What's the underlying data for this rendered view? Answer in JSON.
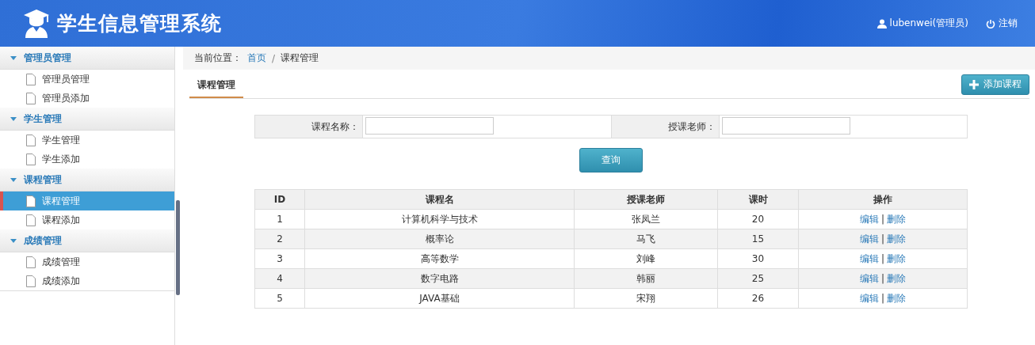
{
  "header": {
    "title": "学生信息管理系统",
    "user": "lubenwei(管理员)",
    "logout": "注销"
  },
  "sidebar": {
    "groups": [
      {
        "label": "管理员管理",
        "expanded": true,
        "items": [
          {
            "label": "管理员管理",
            "selected": false
          },
          {
            "label": "管理员添加",
            "selected": false
          }
        ]
      },
      {
        "label": "学生管理",
        "expanded": true,
        "items": [
          {
            "label": "学生管理",
            "selected": false
          },
          {
            "label": "学生添加",
            "selected": false
          }
        ]
      },
      {
        "label": "课程管理",
        "expanded": true,
        "items": [
          {
            "label": "课程管理",
            "selected": true
          },
          {
            "label": "课程添加",
            "selected": false
          }
        ]
      },
      {
        "label": "成绩管理",
        "expanded": true,
        "items": [
          {
            "label": "成绩管理",
            "selected": false
          },
          {
            "label": "成绩添加",
            "selected": false
          }
        ]
      }
    ]
  },
  "breadcrumb": {
    "label": "当前位置：",
    "links": [
      "首页"
    ],
    "separator": "/",
    "current": "课程管理"
  },
  "tabs": [
    {
      "label": "课程管理",
      "selected": true
    }
  ],
  "add_button": {
    "label": "添加课程"
  },
  "search": {
    "fields": [
      {
        "label": "课程名称："
      },
      {
        "label": "授课老师："
      }
    ],
    "button": "查询"
  },
  "table": {
    "columns": [
      "ID",
      "课程名",
      "授课老师",
      "课时",
      "操作"
    ],
    "rows": [
      {
        "cells": [
          "1",
          "计算机科学与技术",
          "张凤兰",
          "20"
        ],
        "actions": [
          {
            "kind": "link",
            "text": "编辑"
          },
          {
            "kind": "separator",
            "text": "|"
          },
          {
            "kind": "link",
            "text": "删除"
          }
        ]
      },
      {
        "cells": [
          "2",
          "概率论",
          "马飞",
          "15"
        ],
        "actions": [
          {
            "kind": "link",
            "text": "编辑"
          },
          {
            "kind": "separator",
            "text": "|"
          },
          {
            "kind": "link",
            "text": "删除"
          }
        ]
      },
      {
        "cells": [
          "3",
          "高等数学",
          "刘峰",
          "30"
        ],
        "actions": [
          {
            "kind": "link",
            "text": "编辑"
          },
          {
            "kind": "separator",
            "text": "|"
          },
          {
            "kind": "link",
            "text": "删除"
          }
        ]
      },
      {
        "cells": [
          "4",
          "数字电路",
          "韩丽",
          "25"
        ],
        "actions": [
          {
            "kind": "link",
            "text": "编辑"
          },
          {
            "kind": "separator",
            "text": "|"
          },
          {
            "kind": "link",
            "text": "删除"
          }
        ]
      },
      {
        "cells": [
          "5",
          "JAVA基础",
          "宋翔",
          "26"
        ],
        "actions": [
          {
            "kind": "link",
            "text": "编辑"
          },
          {
            "kind": "separator",
            "text": "|"
          },
          {
            "kind": "link",
            "text": "删除"
          }
        ]
      }
    ]
  }
}
